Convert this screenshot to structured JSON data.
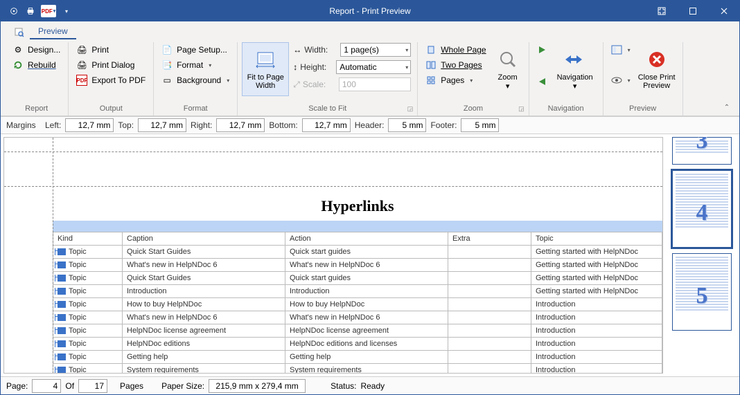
{
  "titlebar": {
    "title": "Report - Print Preview"
  },
  "ribbon": {
    "tab": "Preview",
    "report": {
      "design": "Design...",
      "rebuild": "Rebuild",
      "label": "Report"
    },
    "output": {
      "print": "Print",
      "printDialog": "Print Dialog",
      "exportPdf": "Export To PDF",
      "label": "Output"
    },
    "format": {
      "pageSetup": "Page Setup...",
      "formatBtn": "Format",
      "background": "Background",
      "label": "Format"
    },
    "fit": {
      "fitWidth": "Fit to Page Width"
    },
    "scale": {
      "width": "Width:",
      "widthVal": "1 page(s)",
      "height": "Height:",
      "heightVal": "Automatic",
      "scale": "Scale:",
      "scaleVal": "100",
      "label": "Scale to Fit"
    },
    "pageGroup": {
      "whole": "Whole Page",
      "two": "Two Pages",
      "pages": "Pages"
    },
    "zoom": {
      "zoom": "Zoom",
      "label": "Zoom"
    },
    "nav": {
      "nav": "Navigation",
      "label": "Navigation"
    },
    "preview": {
      "close": "Close Print Preview",
      "label": "Preview"
    }
  },
  "margins": {
    "label": "Margins",
    "left": "Left:",
    "leftVal": "12,7 mm",
    "top": "Top:",
    "topVal": "12,7 mm",
    "right": "Right:",
    "rightVal": "12,7 mm",
    "bottom": "Bottom:",
    "bottomVal": "12,7 mm",
    "header": "Header:",
    "headerVal": "5 mm",
    "footer": "Footer:",
    "footerVal": "5 mm"
  },
  "doc": {
    "title": "Hyperlinks",
    "cols": {
      "kind": "Kind",
      "caption": "Caption",
      "action": "Action",
      "extra": "Extra",
      "topic": "Topic"
    },
    "rows": [
      {
        "kind": "Topic",
        "caption": "Quick Start Guides",
        "action": "Quick start guides",
        "extra": "",
        "topic": "Getting started with HelpNDoc"
      },
      {
        "kind": "Topic",
        "caption": "What's new in HelpNDoc 6",
        "action": "What's new in HelpNDoc 6",
        "extra": "",
        "topic": "Getting started with HelpNDoc"
      },
      {
        "kind": "Topic",
        "caption": "Quick Start Guides",
        "action": "Quick start guides",
        "extra": "",
        "topic": "Getting started with HelpNDoc"
      },
      {
        "kind": "Topic",
        "caption": "Introduction",
        "action": "Introduction",
        "extra": "",
        "topic": "Getting started with HelpNDoc"
      },
      {
        "kind": "Topic",
        "caption": "How to buy HelpNDoc",
        "action": "How to buy HelpNDoc",
        "extra": "",
        "topic": "Introduction"
      },
      {
        "kind": "Topic",
        "caption": "What's new in HelpNDoc 6",
        "action": "What's new in HelpNDoc 6",
        "extra": "",
        "topic": "Introduction"
      },
      {
        "kind": "Topic",
        "caption": "HelpNDoc license agreement",
        "action": "HelpNDoc license agreement",
        "extra": "",
        "topic": "Introduction"
      },
      {
        "kind": "Topic",
        "caption": "HelpNDoc editions",
        "action": "HelpNDoc editions and licenses",
        "extra": "",
        "topic": "Introduction"
      },
      {
        "kind": "Topic",
        "caption": "Getting help",
        "action": "Getting help",
        "extra": "",
        "topic": "Introduction"
      },
      {
        "kind": "Topic",
        "caption": "System requirements",
        "action": "System requirements",
        "extra": "",
        "topic": "Introduction"
      }
    ]
  },
  "thumbs": {
    "p3": "3",
    "p4": "4",
    "p5": "5"
  },
  "status": {
    "page": "Page:",
    "pageVal": "4",
    "of": "Of",
    "total": "17",
    "pages": "Pages",
    "paper": "Paper Size:",
    "paperVal": "215,9 mm x 279,4 mm",
    "status": "Status:",
    "statusVal": "Ready"
  }
}
